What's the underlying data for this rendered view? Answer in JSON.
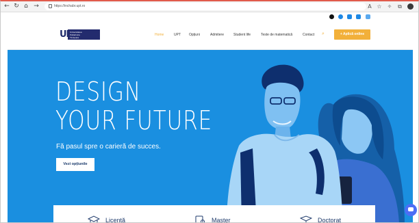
{
  "browser": {
    "url": "https://inchabr.upt.ro",
    "back_glyph": "←",
    "forward_glyph": "→",
    "reload_glyph": "↻",
    "home_glyph": "⌂",
    "ext_glyph_1": "A",
    "ext_glyph_2": "☆",
    "ext_glyph_3": "✧",
    "ext_glyph_4": "⧉"
  },
  "header": {
    "logo_mark": "UP",
    "logo_lines": [
      "Universitatea",
      "Politehnica",
      "Timișoara"
    ],
    "nav": [
      "Home",
      "UPT",
      "Opțiuni",
      "Admitere",
      "Student life",
      "Teste de matematică",
      "Contact"
    ],
    "apply_label": "+ Aplică online",
    "social_icons": [
      "tiktok-icon",
      "facebook-icon",
      "linkedin-icon",
      "youtube-icon",
      "instagram-icon"
    ]
  },
  "hero": {
    "title_line1": "DESIGN",
    "title_line2": "YOUR FUTURE",
    "subtitle": "Fă pasul spre o carieră de succes.",
    "cta_label": "Vezi opțiunile",
    "background_color": "#1a8fe0"
  },
  "study_levels": [
    "Licență",
    "Master",
    "Doctorat"
  ],
  "colors": {
    "accent": "#f2b03a",
    "brand": "#232b6e",
    "hero": "#1a8fe0"
  }
}
